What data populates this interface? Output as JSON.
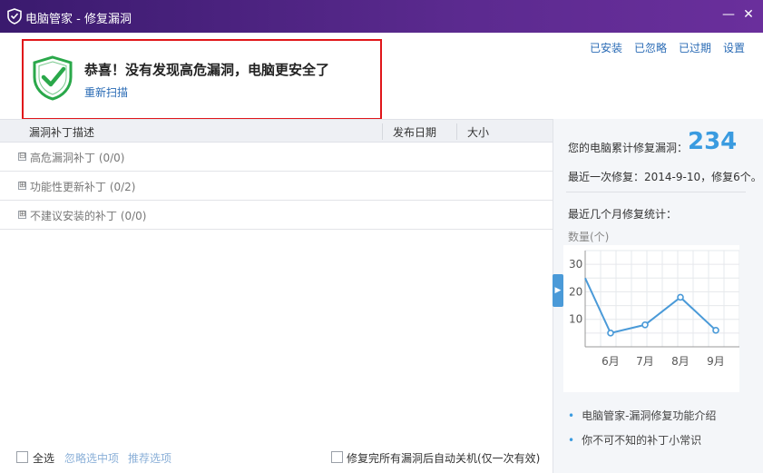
{
  "window": {
    "title": "电脑管家 - 修复漏洞"
  },
  "topnav": {
    "installed": "已安装",
    "ignored": "已忽略",
    "expired": "已过期",
    "settings": "设置"
  },
  "status": {
    "headline": "恭喜！没有发现高危漏洞，电脑更安全了",
    "rescan": "重新扫描"
  },
  "table": {
    "columns": {
      "desc": "漏洞补丁描述",
      "date": "发布日期",
      "size": "大小"
    },
    "groups": [
      {
        "label": "高危漏洞补丁 (0/0)",
        "expander": "⊟"
      },
      {
        "label": "功能性更新补丁 (0/2)",
        "expander": "⊞"
      },
      {
        "label": "不建议安装的补丁 (0/0)",
        "expander": "⊞"
      }
    ]
  },
  "footer": {
    "select_all": "全选",
    "ignore_selected": "忽略选中项",
    "recommend": "推荐选项",
    "shutdown": "修复完所有漏洞后自动关机(仅一次有效)"
  },
  "stats": {
    "total_label": "您的电脑累计修复漏洞：",
    "total": "234",
    "last_repair": "最近一次修复：2014-9-10，修复6个。",
    "recent_label": "最近几个月修复统计：",
    "count_label": "数量(个)"
  },
  "chart_data": {
    "type": "line",
    "categories": [
      "6月",
      "7月",
      "8月",
      "9月"
    ],
    "series": [
      {
        "values": [
          5,
          8,
          18,
          6
        ]
      }
    ],
    "lead_in_value": 25,
    "ylabel": "数量(个)",
    "ylim": [
      0,
      35
    ],
    "yticks": [
      "10",
      "20",
      "30"
    ],
    "grid": true,
    "color": "#4a9ad8"
  },
  "tips": [
    "电脑管家-漏洞修复功能介绍",
    "你不可不知的补丁小常识"
  ]
}
